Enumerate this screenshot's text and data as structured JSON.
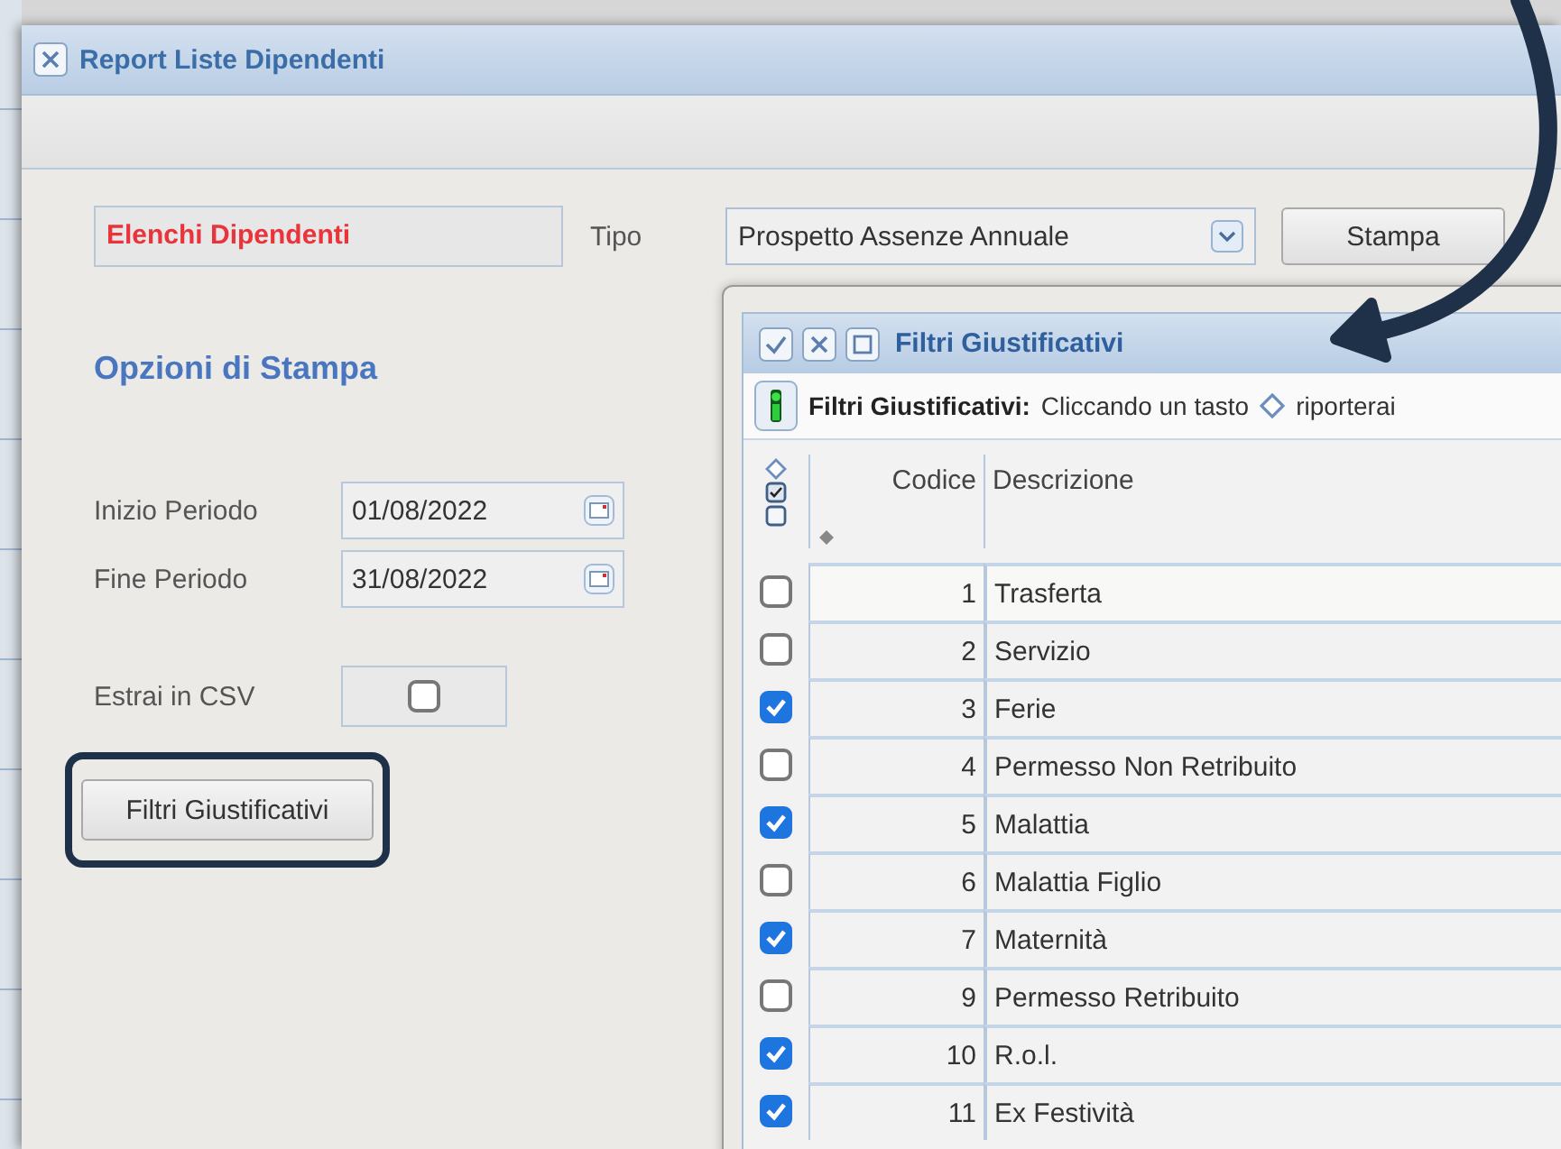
{
  "window": {
    "title": "Report Liste Dipendenti"
  },
  "report": {
    "name": "Elenchi Dipendenti",
    "type_label": "Tipo",
    "type_value": "Prospetto Assenze Annuale",
    "print_button": "Stampa"
  },
  "options": {
    "title": "Opzioni di Stampa",
    "dates": [
      {
        "label": "Inizio Periodo",
        "value": "01/08/2022"
      },
      {
        "label": "Fine Periodo",
        "value": "31/08/2022"
      }
    ],
    "csv": {
      "label": "Estrai in CSV",
      "checked": false
    },
    "filter_button": "Filtri Giustificativi"
  },
  "dialog": {
    "title": "Filtri Giustificativi",
    "info_title": "Filtri Giustificativi:",
    "info_text": "Cliccando un tasto",
    "info_text_after": "riporterai",
    "columns": [
      "Codice",
      "Descrizione"
    ],
    "rows": [
      {
        "code": "1",
        "description": "Trasferta",
        "checked": false
      },
      {
        "code": "2",
        "description": "Servizio",
        "checked": false
      },
      {
        "code": "3",
        "description": "Ferie",
        "checked": true
      },
      {
        "code": "4",
        "description": "Permesso Non Retribuito",
        "checked": false
      },
      {
        "code": "5",
        "description": "Malattia",
        "checked": true
      },
      {
        "code": "6",
        "description": "Malattia Figlio",
        "checked": false
      },
      {
        "code": "7",
        "description": "Maternità",
        "checked": true
      },
      {
        "code": "9",
        "description": "Permesso Retribuito",
        "checked": false
      },
      {
        "code": "10",
        "description": "R.o.l.",
        "checked": true
      },
      {
        "code": "11",
        "description": "Ex Festività",
        "checked": true
      }
    ]
  }
}
